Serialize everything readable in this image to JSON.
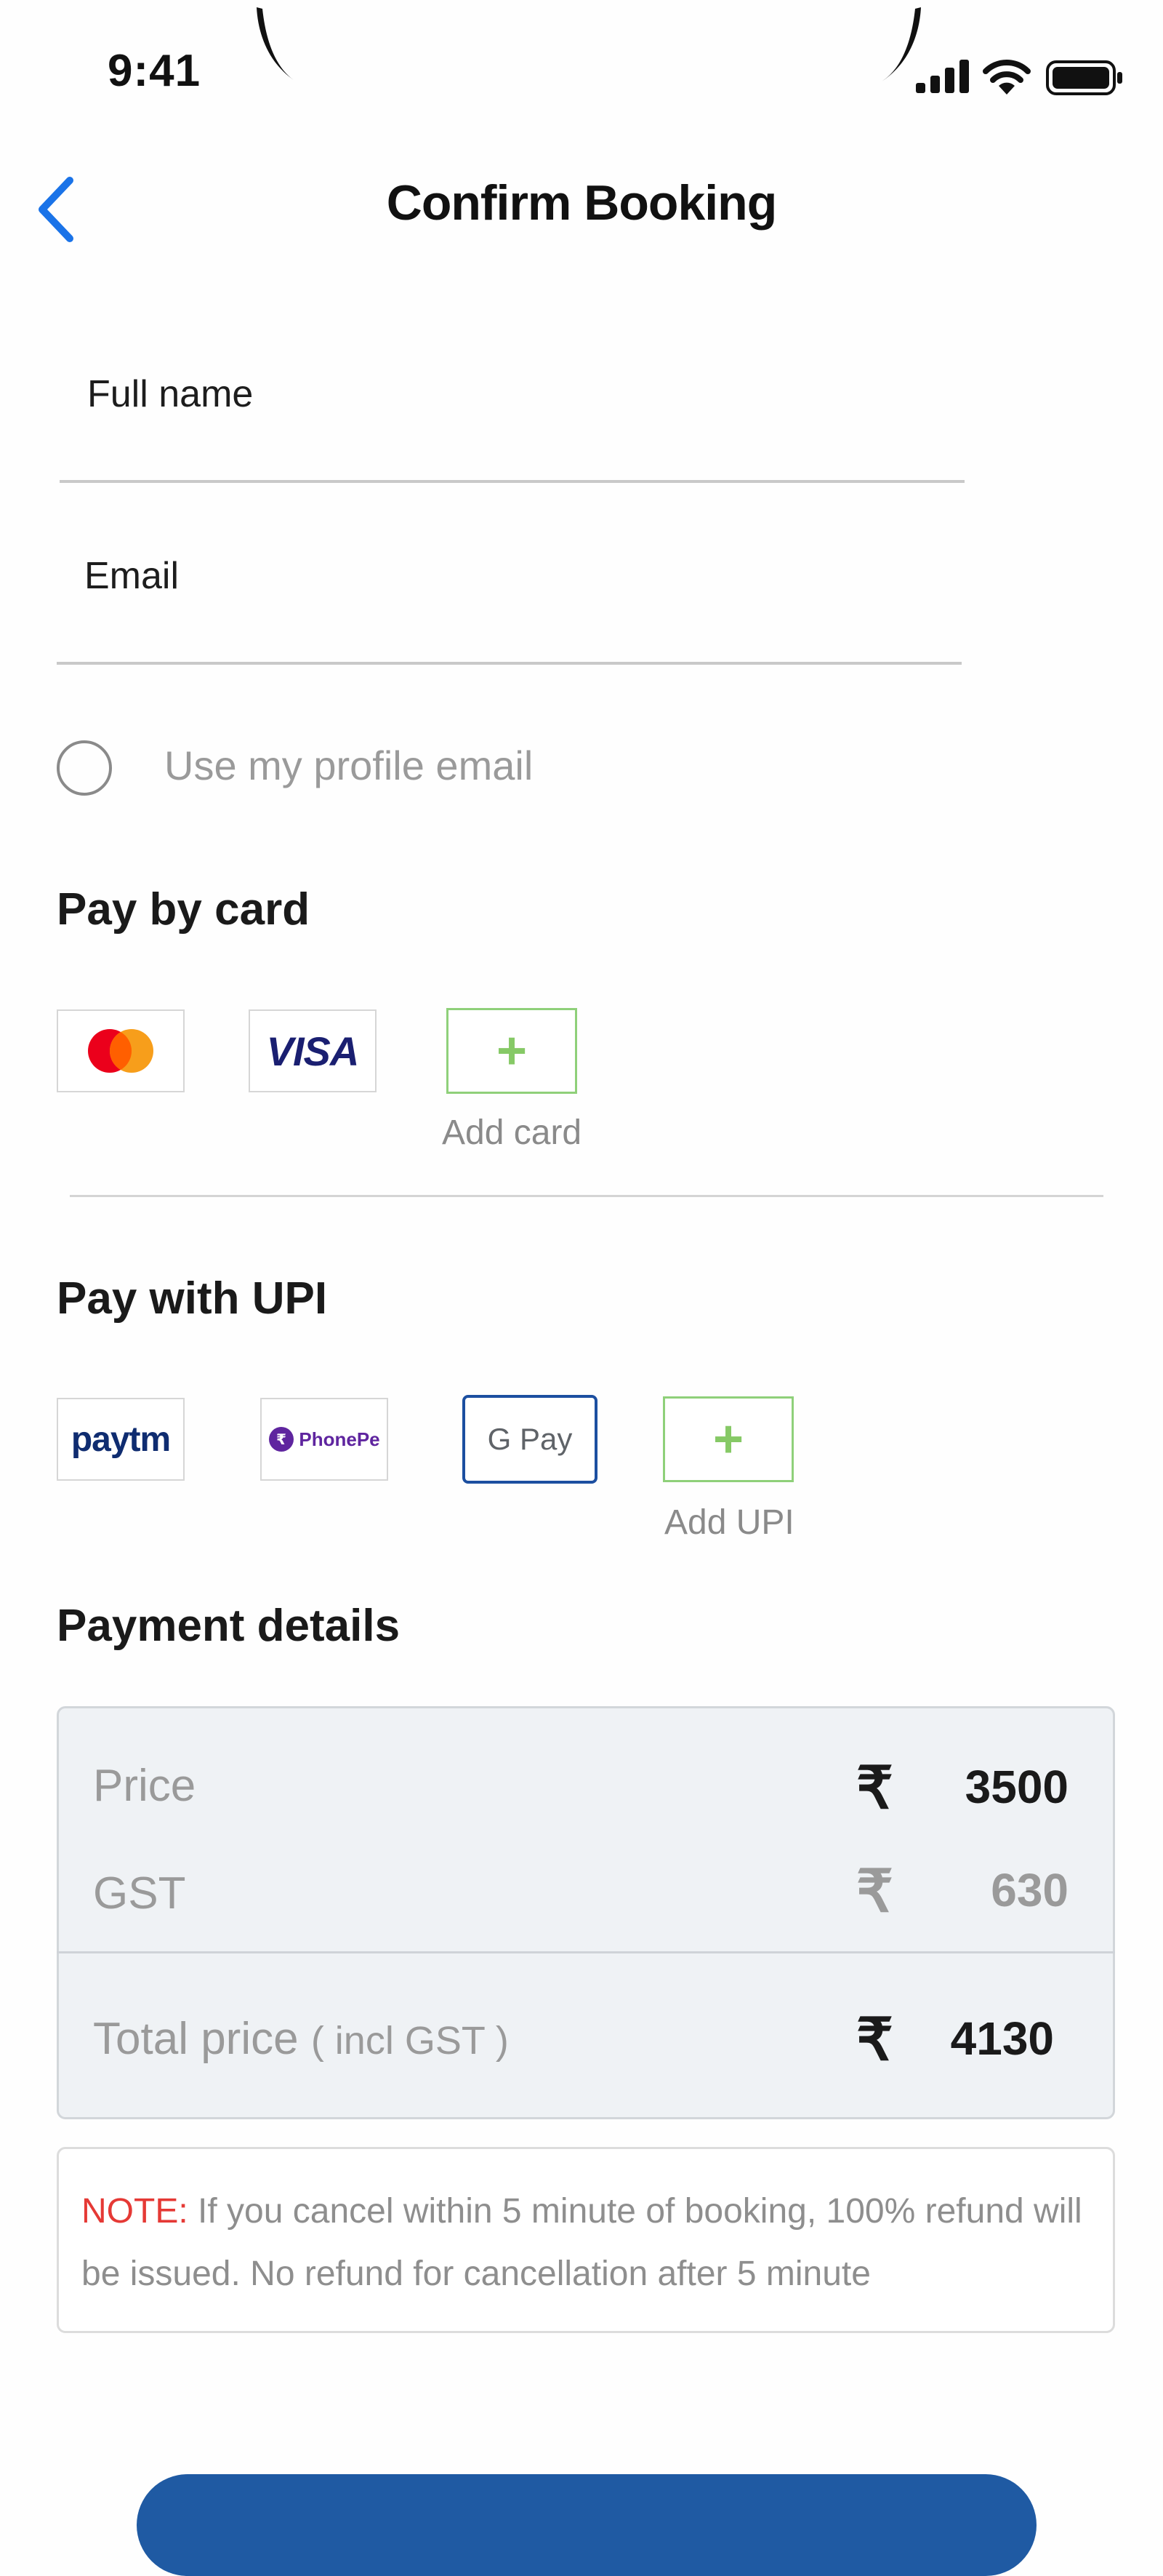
{
  "status_bar": {
    "time": "9:41"
  },
  "header": {
    "title": "Confirm Booking"
  },
  "form": {
    "full_name_placeholder": "Full name",
    "email_placeholder": "Email",
    "use_profile_email_label": "Use my profile email",
    "use_profile_email_checked": false
  },
  "pay_by_card": {
    "title": "Pay by card",
    "options": [
      "mastercard-icon",
      "VISA"
    ],
    "add_label": "Add card"
  },
  "pay_with_upi": {
    "title": "Pay with UPI",
    "options": [
      "paytm",
      "PhonePe",
      "G Pay"
    ],
    "selected": "G Pay",
    "add_label": "Add UPI"
  },
  "payment_details": {
    "title": "Payment details",
    "currency_symbol": "₹",
    "price_label": "Price",
    "price_value": "3500",
    "gst_label": "GST",
    "gst_value": "630",
    "total_label": "Total price",
    "total_suffix": "( incl GST )",
    "total_value": "4130"
  },
  "note": {
    "prefix": "NOTE:",
    "text": " If you cancel within 5 minute of booking, 100% refund will be issued. No refund for cancellation after 5 minute"
  },
  "colors": {
    "accent_blue": "#1f5aa3",
    "back_arrow": "#1a73e8",
    "add_green": "#86c966",
    "note_red": "#e53935"
  }
}
